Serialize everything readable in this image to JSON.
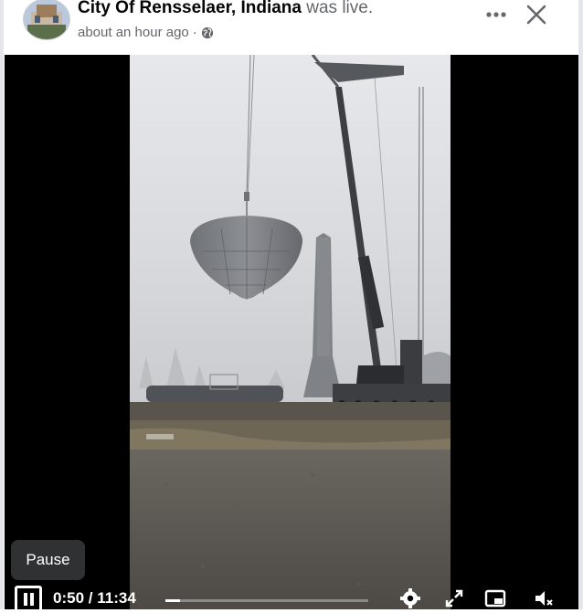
{
  "post": {
    "page_name": "City Of Rensselaer, Indiana",
    "status_text": "was live.",
    "time_ago": "about an hour ago",
    "separator": "·",
    "audience_icon": "globe-icon"
  },
  "header_actions": {
    "more_icon": "more-options-icon",
    "close_icon": "close-icon"
  },
  "player": {
    "tooltip": "Pause",
    "current_time": "0:50",
    "time_separator": "/",
    "duration": "11:34",
    "progress_fraction": 0.072,
    "icons": [
      "pause-icon",
      "settings-icon",
      "fullscreen-icon",
      "picture-in-picture-icon",
      "mute-icon"
    ]
  },
  "colors": {
    "name": "#050505",
    "secondary": "#65676b",
    "video_bg": "#000000",
    "tooltip_bg": "#303133"
  }
}
